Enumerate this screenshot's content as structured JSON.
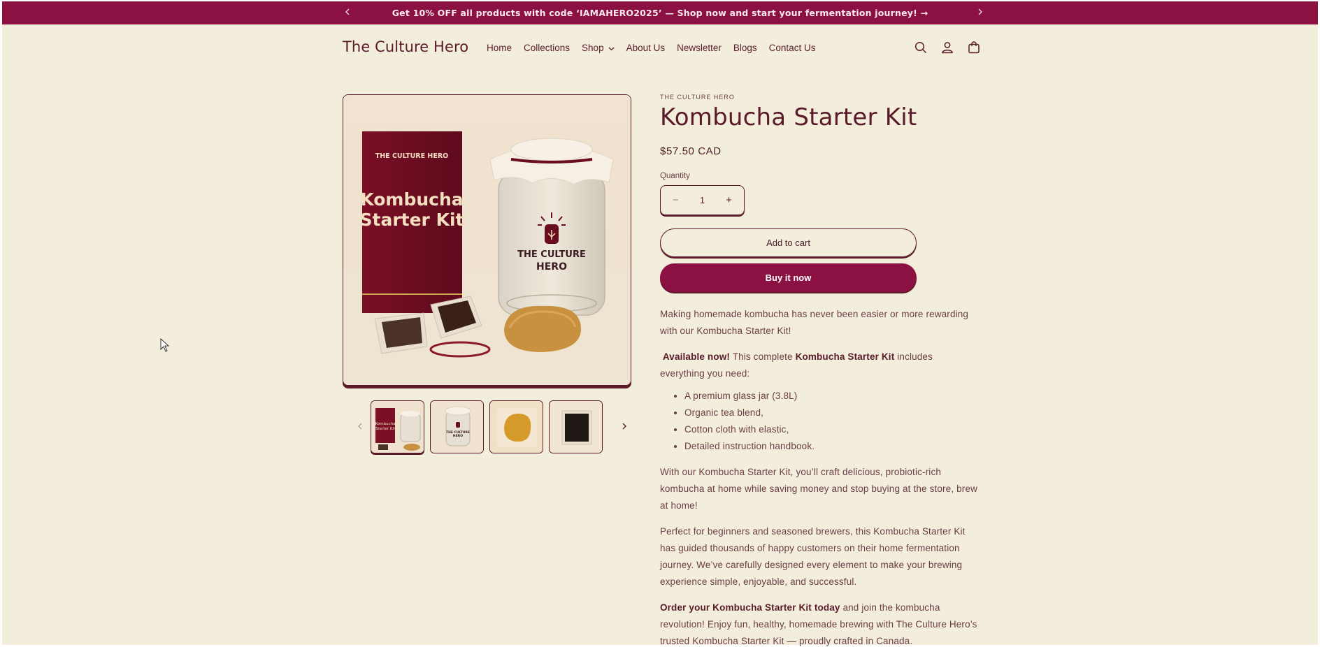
{
  "announcement": {
    "text": "Get 10% OFF all products with code ‘IAMAHERO2025’ — Shop now and start your fermentation journey! →",
    "prev_icon": "chevron-left-icon",
    "next_icon": "chevron-right-icon"
  },
  "header": {
    "logo": "The Culture Hero",
    "nav": [
      {
        "label": "Home"
      },
      {
        "label": "Collections"
      },
      {
        "label": "Shop"
      },
      {
        "label": "About Us"
      },
      {
        "label": "Newsletter"
      },
      {
        "label": "Blogs"
      },
      {
        "label": "Contact Us"
      }
    ],
    "icons": [
      "search-icon",
      "account-icon",
      "cart-icon"
    ]
  },
  "gallery": {
    "main_image": {
      "box_brand": "THE CULTURE HERO",
      "box_title_line1": "Kombucha",
      "box_title_line2": "Starter Kit",
      "jar_brand_line1": "THE CULTURE",
      "jar_brand_line2": "HERO"
    },
    "thumbnails": [
      "kit-overview",
      "glass-jar",
      "scoby",
      "tea-blend"
    ],
    "active_thumbnail": 0
  },
  "product": {
    "vendor": "THE CULTURE HERO",
    "title": "Kombucha Starter Kit",
    "price": "$57.50 CAD",
    "quantity_label": "Quantity",
    "quantity_value": "1",
    "minus": "−",
    "plus": "+",
    "add_to_cart": "Add to cart",
    "buy_now": "Buy it now"
  },
  "description": {
    "p1": "Making homemade kombucha has never been easier or more rewarding with our Kombucha Starter Kit!",
    "p2_bold1": "Available now!",
    "p2_text1": " This complete ",
    "p2_bold2": "Kombucha Starter Kit",
    "p2_text2": " includes everything you need:",
    "items": [
      "A premium glass jar (3.8L)",
      "Organic tea blend,",
      "Cotton cloth with elastic,",
      "Detailed instruction handbook."
    ],
    "p3": "With our Kombucha Starter Kit, you’ll craft delicious, probiotic-rich kombucha at home while saving money and stop buying at the store, brew at home!",
    "p4": "Perfect for beginners and seasoned brewers, this Kombucha Starter Kit has guided thousands of happy customers on their home fermentation journey. We’ve carefully designed every element to make your brewing experience simple, enjoyable, and successful.",
    "p5_bold": "Order your Kombucha Starter Kit today",
    "p5_text": " and join the kombucha revolution! Enjoy fun, healthy, homemade brewing with The Culture Hero’s trusted Kombucha Starter Kit — proudly crafted in Canada."
  },
  "colors": {
    "background": "#f3eedc",
    "brand": "#8b1142",
    "text": "#5a1a2a"
  }
}
